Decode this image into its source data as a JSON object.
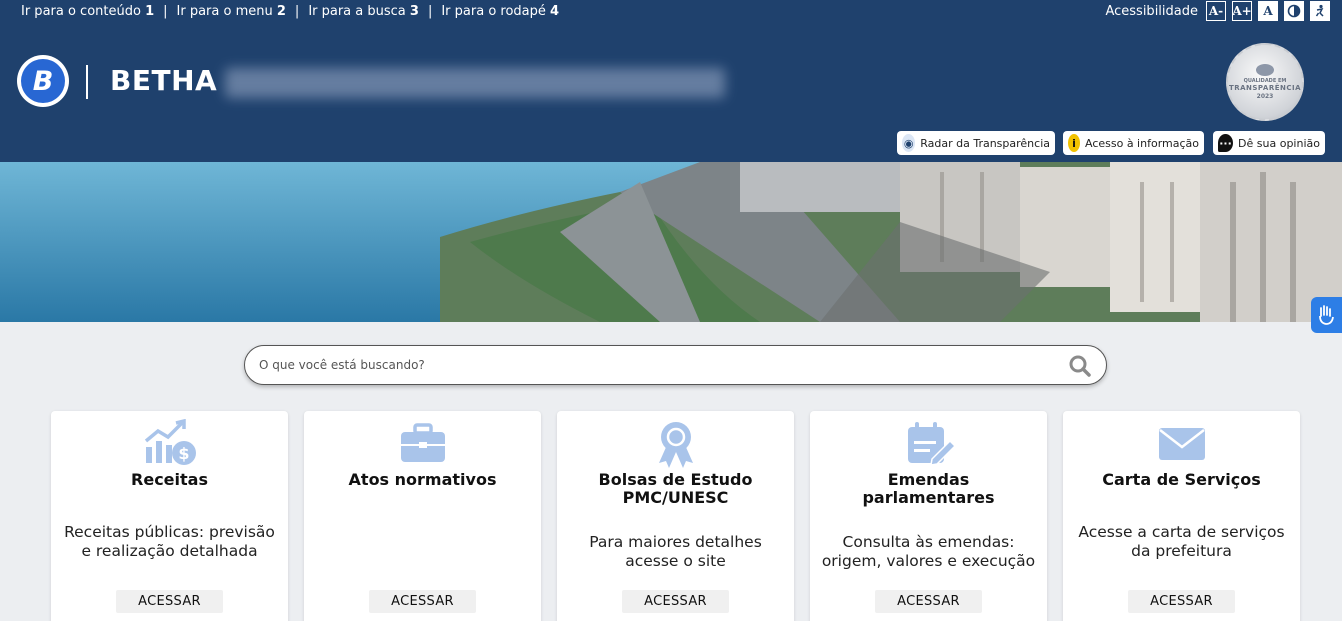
{
  "skiplinks": [
    {
      "label": "Ir para o conteúdo",
      "num": "1"
    },
    {
      "label": "Ir para o menu",
      "num": "2"
    },
    {
      "label": "Ir para a busca",
      "num": "3"
    },
    {
      "label": "Ir para o rodapé",
      "num": "4"
    }
  ],
  "accessibility": {
    "label": "Acessibilidade",
    "decrease_font": "A-",
    "increase_font": "A+",
    "normal_font": "A"
  },
  "brand": {
    "logo_letter": "B",
    "name": "BETHA"
  },
  "seal": {
    "line1": "QUALIDADE EM",
    "line2": "TRANSPARÊNCIA",
    "year": "2023"
  },
  "quick_links": {
    "radar": "Radar da Transparência",
    "info": "Acesso à informação",
    "opinion": "Dê sua opinião"
  },
  "search": {
    "placeholder": "O que você está buscando?"
  },
  "cards": [
    {
      "title": "Receitas",
      "desc1": "Receitas públicas: previsão",
      "desc2": "e realização detalhada",
      "button": "ACESSAR",
      "icon": "chart-money-icon"
    },
    {
      "title": "Atos normativos",
      "desc1": "",
      "desc2": "",
      "button": "ACESSAR",
      "icon": "briefcase-icon"
    },
    {
      "title": "Bolsas de Estudo",
      "title2": "PMC/UNESC",
      "desc1": "Para maiores detalhes",
      "desc2": "acesse o site",
      "button": "ACESSAR",
      "icon": "award-icon"
    },
    {
      "title": "Emendas",
      "title2": "parlamentares",
      "desc1": "Consulta às emendas:",
      "desc2": "origem, valores e execução",
      "button": "ACESSAR",
      "icon": "calendar-edit-icon"
    },
    {
      "title": "Carta de Serviços",
      "desc1": "Acesse a carta de serviços",
      "desc2": "da prefeitura",
      "button": "ACESSAR",
      "icon": "envelope-icon"
    }
  ],
  "colors": {
    "header_bg": "#1f416d",
    "icon_light_blue": "#a9c4ea",
    "vlibras_blue": "#2d7ee6"
  }
}
